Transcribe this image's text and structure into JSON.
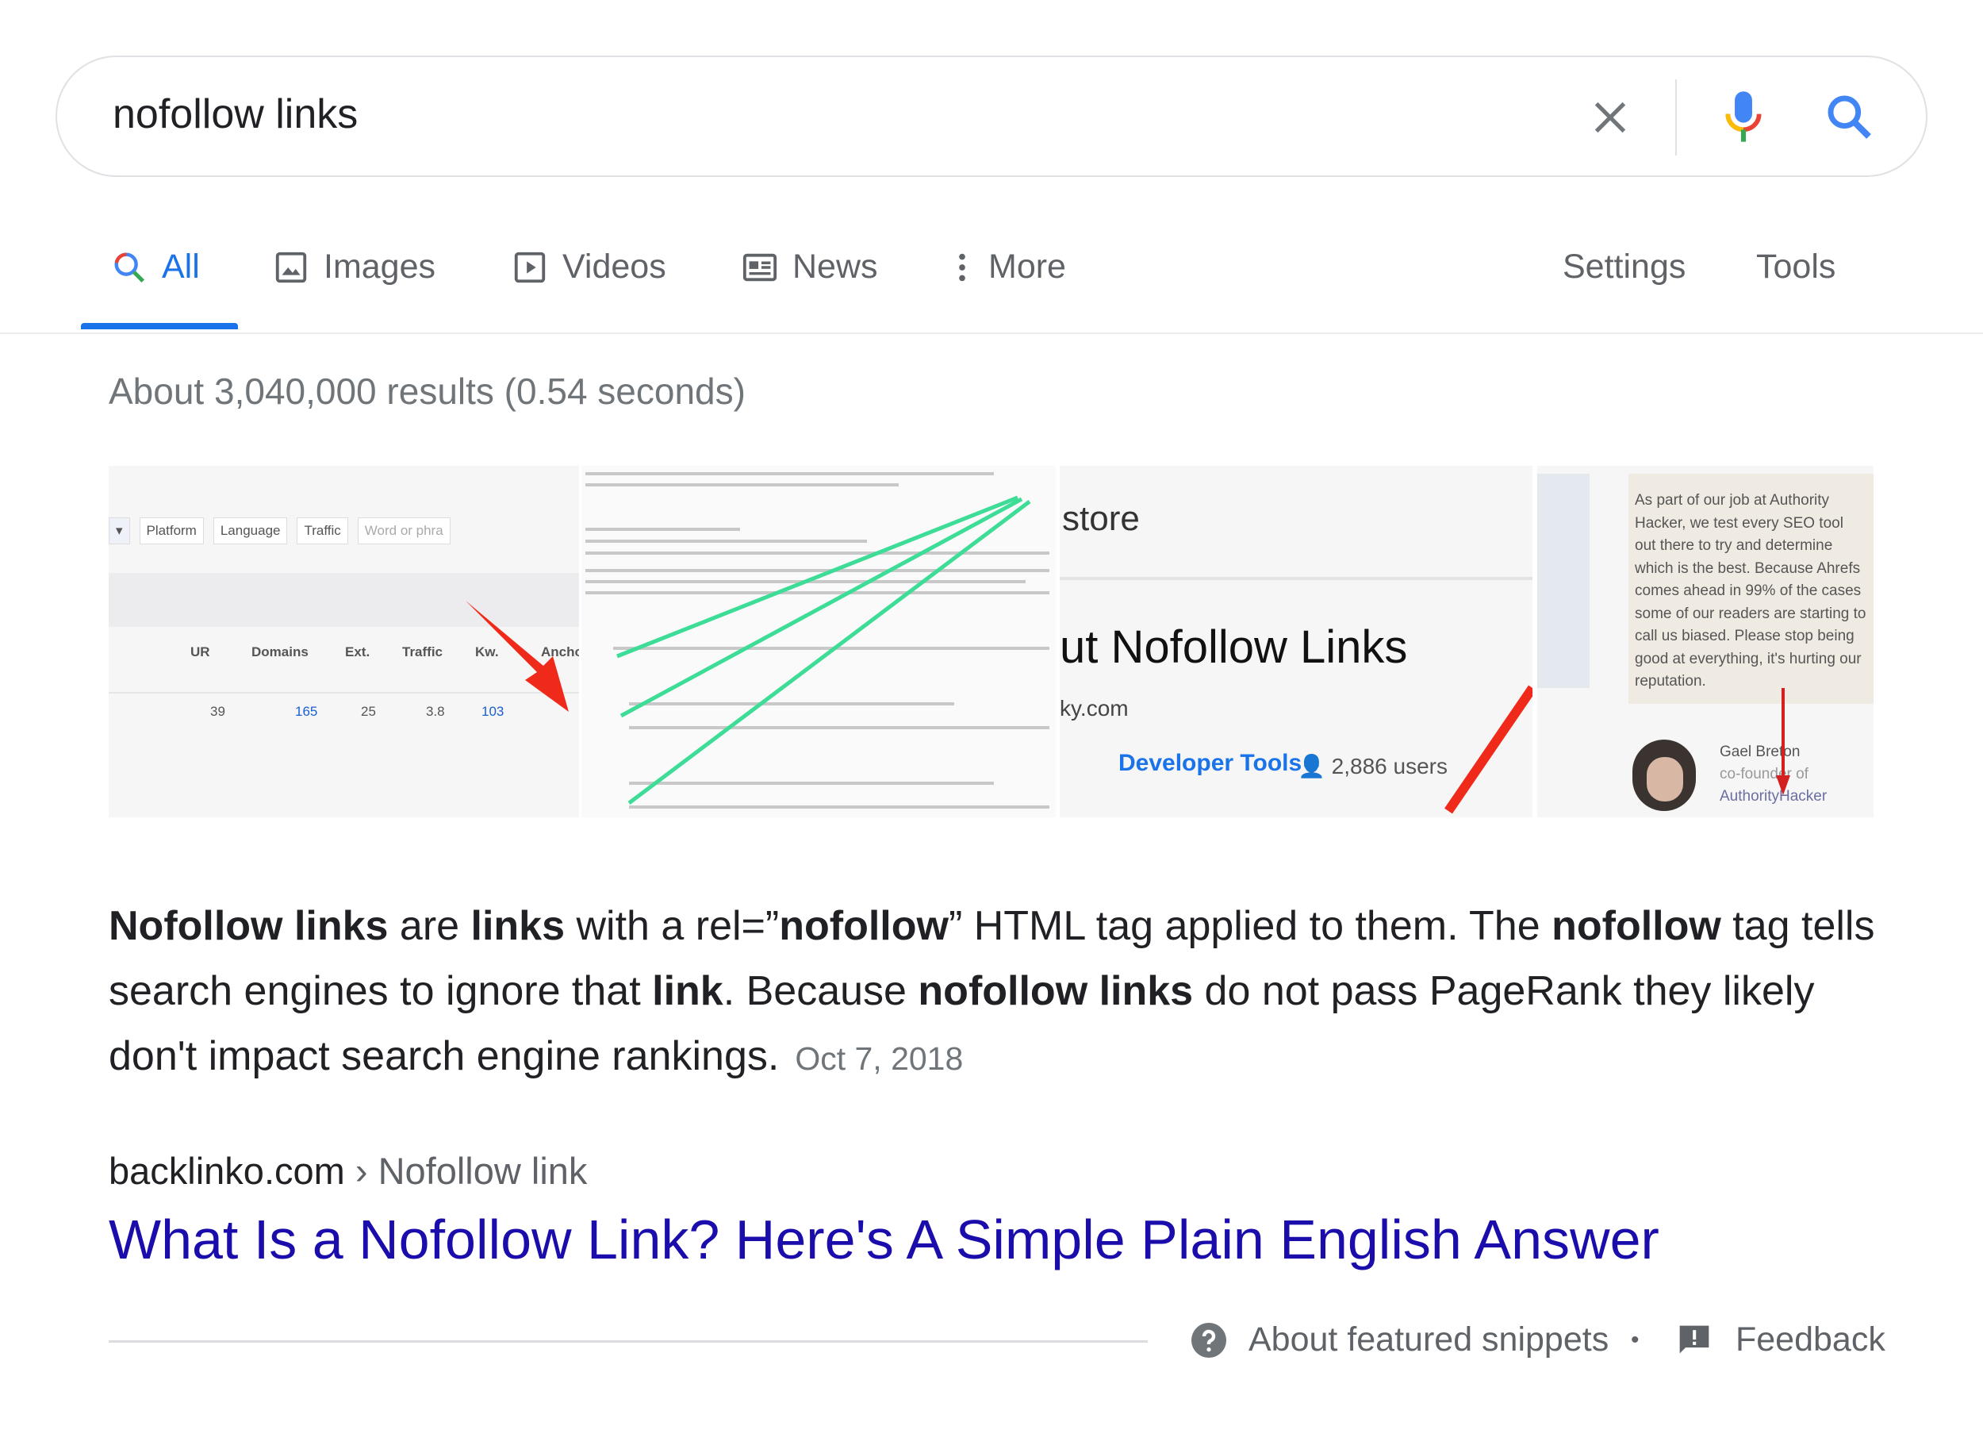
{
  "search": {
    "query": "nofollow links"
  },
  "tabs": [
    {
      "label": "All",
      "icon": "search-icon",
      "active": true
    },
    {
      "label": "Images",
      "icon": "image-icon"
    },
    {
      "label": "Videos",
      "icon": "video-icon"
    },
    {
      "label": "News",
      "icon": "news-icon"
    },
    {
      "label": "More",
      "icon": "more-vert-icon"
    }
  ],
  "tools": {
    "settings": "Settings",
    "tools": "Tools"
  },
  "stats": "About 3,040,000 results (0.54 seconds)",
  "images": {
    "img1": {
      "filters": [
        "Platform",
        "Language",
        "Traffic",
        "Word or phra"
      ],
      "columns": [
        "UR",
        "Domains",
        "Ext.",
        "Traffic",
        "Kw.",
        "Ancho"
      ],
      "row": [
        "39",
        "165",
        "25",
        "3.8",
        "103"
      ]
    },
    "img3": {
      "store": "store",
      "heading": "ut Nofollow Links",
      "domain": "ky.com",
      "category": "Developer Tools",
      "users": "2,886 users"
    },
    "img4": {
      "quote": "As part of our job at Authority Hacker, we test every SEO tool out there to try and determine which is the best. Because Ahrefs comes ahead in 99% of the cases some of our readers are starting to call us biased. Please stop being good at everything, it's hurting our reputation.",
      "name": "Gael Breton",
      "role": "co-founder of",
      "company": "AuthorityHacker"
    }
  },
  "snippet": {
    "parts": [
      {
        "t": "Nofollow links",
        "b": true
      },
      {
        "t": " are "
      },
      {
        "t": "links",
        "b": true
      },
      {
        "t": " with a rel=”"
      },
      {
        "t": "nofollow",
        "b": true
      },
      {
        "t": "” HTML tag applied to them. The "
      },
      {
        "t": "nofollow",
        "b": true
      },
      {
        "t": " tag tells search engines to ignore that "
      },
      {
        "t": "link",
        "b": true
      },
      {
        "t": ". Because "
      },
      {
        "t": "nofollow links",
        "b": true
      },
      {
        "t": " do not pass PageRank they likely don't impact search engine rankings."
      }
    ],
    "date": "Oct 7, 2018"
  },
  "result": {
    "domain": "backlinko.com",
    "separator": "›",
    "path": "Nofollow link",
    "title": "What Is a Nofollow Link? Here's A Simple Plain English Answer"
  },
  "footer": {
    "about": "About featured snippets",
    "dot": "•",
    "feedback": "Feedback"
  },
  "colors": {
    "accent": "#1a73e8",
    "link": "#1a0dab",
    "arrow": "#f02a1a",
    "green": "#3ddc97"
  }
}
